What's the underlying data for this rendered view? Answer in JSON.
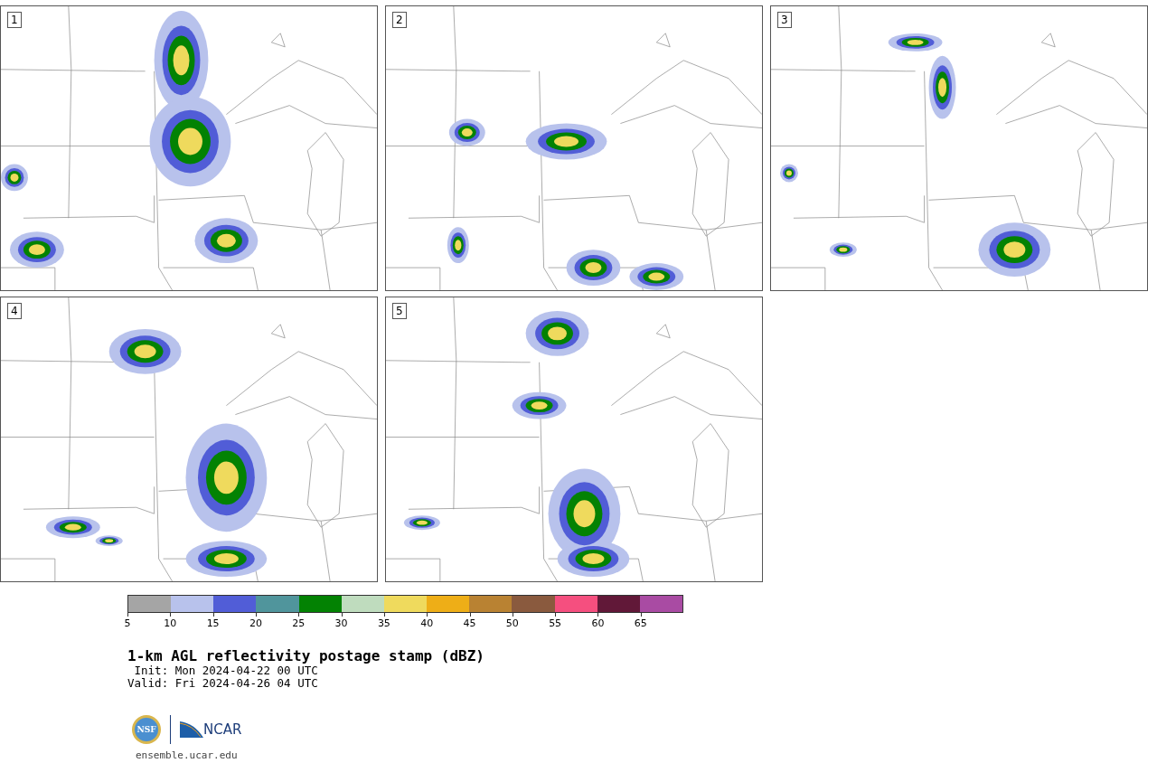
{
  "panels": [
    {
      "label": "1"
    },
    {
      "label": "2"
    },
    {
      "label": "3"
    },
    {
      "label": "4"
    },
    {
      "label": "5"
    }
  ],
  "colorbar": {
    "segments": [
      {
        "color": "#a5a5a5"
      },
      {
        "color": "#b8c2ec"
      },
      {
        "color": "#515dd7"
      },
      {
        "color": "#50959c"
      },
      {
        "color": "#038203"
      },
      {
        "color": "#bfdcbe"
      },
      {
        "color": "#efda5d"
      },
      {
        "color": "#eeae17"
      },
      {
        "color": "#b98232"
      },
      {
        "color": "#8a5a3e"
      },
      {
        "color": "#f54f7f"
      },
      {
        "color": "#611838"
      },
      {
        "color": "#a94ba3"
      }
    ],
    "ticks": [
      "5",
      "10",
      "15",
      "20",
      "25",
      "30",
      "35",
      "40",
      "45",
      "50",
      "55",
      "60",
      "65"
    ]
  },
  "title": "1-km AGL reflectivity postage stamp (dBZ)",
  "init": " Init: Mon 2024-04-22 00 UTC",
  "valid": "Valid: Fri 2024-04-26 04 UTC",
  "logos": {
    "nsf": "NSF",
    "ncar": "NCAR"
  },
  "url": "ensemble.ucar.edu"
}
